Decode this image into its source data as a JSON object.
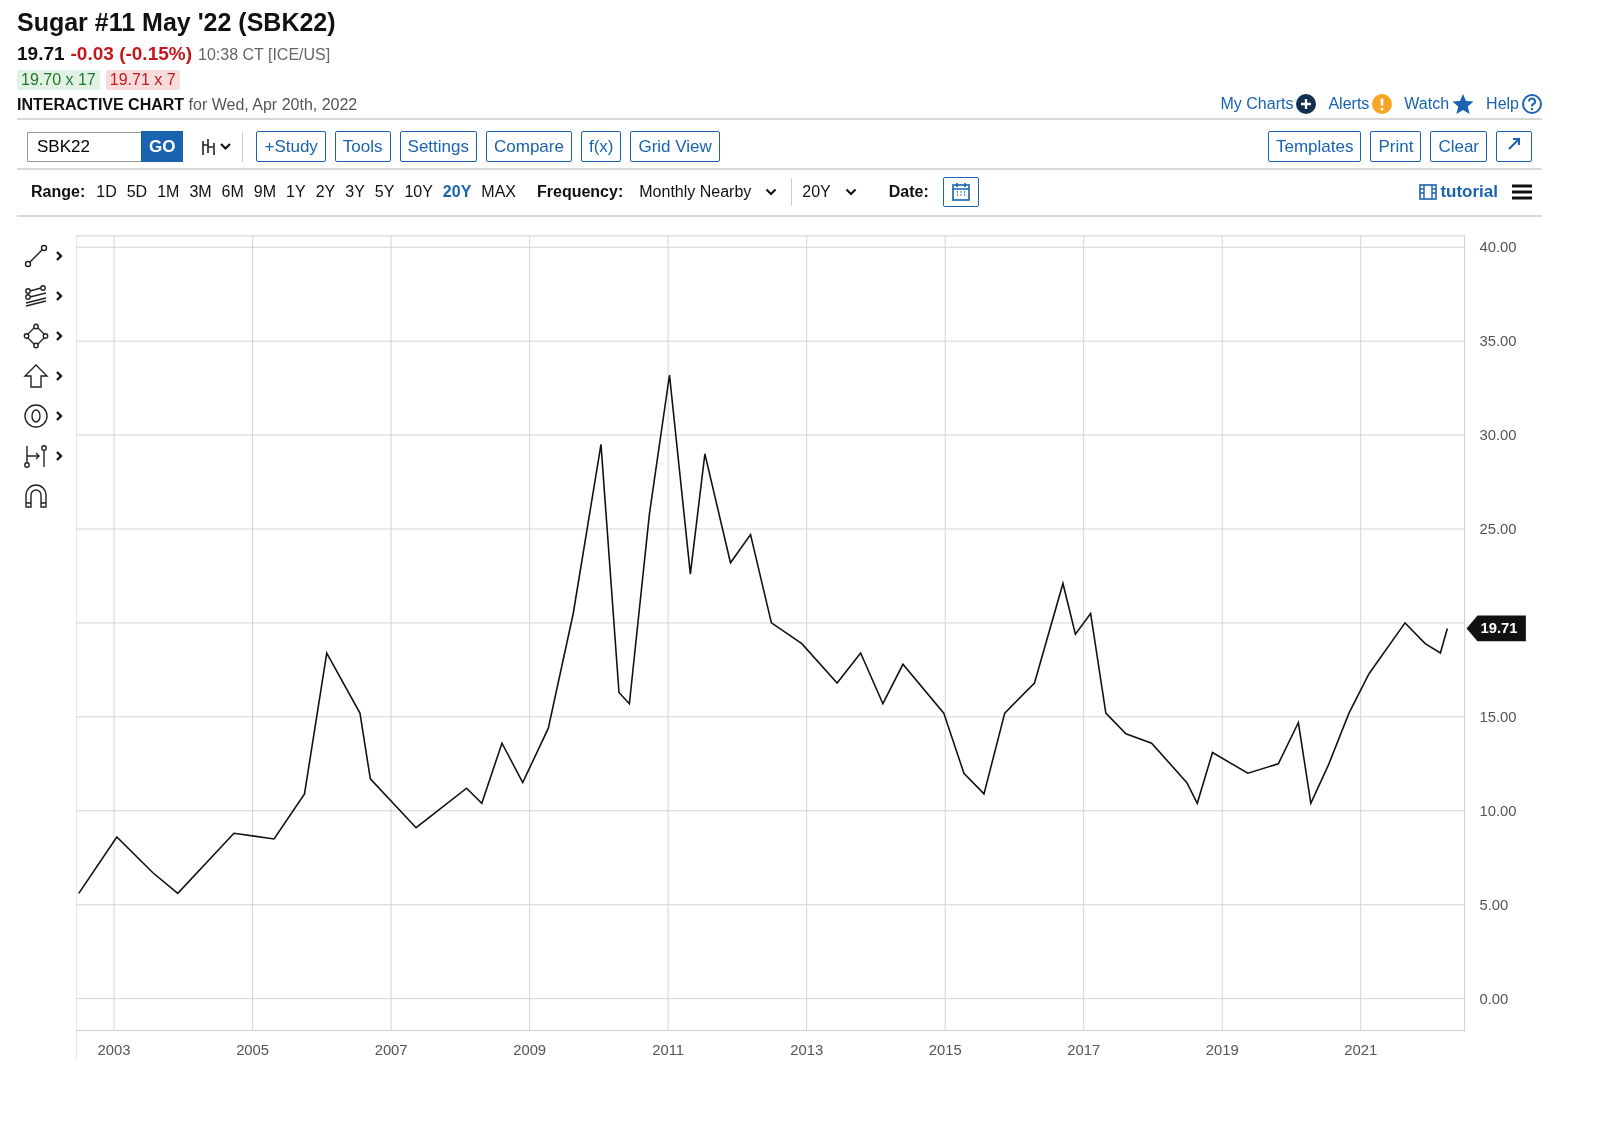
{
  "title": "Sugar #11 May '22 (SBK22)",
  "quote": {
    "last": "19.71",
    "change": "-0.03 (-0.15%)",
    "time": "10:38 CT [ICE/US]"
  },
  "bid": "19.70 x 17",
  "ask": "19.71 x 7",
  "chart_heading": {
    "label": "INTERACTIVE CHART",
    "date": "for Wed, Apr 20th, 2022"
  },
  "header_links": [
    {
      "label": "My Charts",
      "kind": "plus"
    },
    {
      "label": "Alerts",
      "kind": "alert"
    },
    {
      "label": "Watch",
      "kind": "star"
    },
    {
      "label": "Help",
      "kind": "help"
    }
  ],
  "symbol_input": {
    "value": "SBK22"
  },
  "go_button": "GO",
  "toolbar_buttons": [
    "+Study",
    "Tools",
    "Settings",
    "Compare",
    "f(x)",
    "Grid View"
  ],
  "right_buttons": [
    "Templates",
    "Print",
    "Clear"
  ],
  "range": {
    "label": "Range:",
    "options": [
      {
        "label": "1D",
        "selected": false
      },
      {
        "label": "5D",
        "selected": false
      },
      {
        "label": "1M",
        "selected": false
      },
      {
        "label": "3M",
        "selected": false
      },
      {
        "label": "6M",
        "selected": false
      },
      {
        "label": "9M",
        "selected": false
      },
      {
        "label": "1Y",
        "selected": false
      },
      {
        "label": "2Y",
        "selected": false
      },
      {
        "label": "3Y",
        "selected": false
      },
      {
        "label": "5Y",
        "selected": false
      },
      {
        "label": "10Y",
        "selected": false
      },
      {
        "label": "20Y",
        "selected": true
      },
      {
        "label": "MAX",
        "selected": false
      }
    ]
  },
  "frequency": {
    "label": "Frequency:",
    "value": "Monthly Nearby"
  },
  "period": {
    "value": "20Y"
  },
  "date": {
    "label": "Date:"
  },
  "tutorial": "tutorial",
  "drawing_tools": [
    {
      "kind": "line",
      "submenu": true
    },
    {
      "kind": "channel",
      "submenu": true
    },
    {
      "kind": "shape",
      "submenu": true
    },
    {
      "kind": "arrow",
      "submenu": true
    },
    {
      "kind": "circle",
      "submenu": true
    },
    {
      "kind": "measure",
      "submenu": true
    },
    {
      "kind": "magnet",
      "submenu": false
    }
  ],
  "chart": {
    "last_price_label": "19.71",
    "chart_data": {
      "type": "line",
      "xlim": [
        2002.45,
        2022.5
      ],
      "ylim": [
        -1.7,
        40.6
      ],
      "xticks": [
        {
          "value": 2003,
          "label": "2003"
        },
        {
          "value": 2005,
          "label": "2005"
        },
        {
          "value": 2007,
          "label": "2007"
        },
        {
          "value": 2009,
          "label": "2009"
        },
        {
          "value": 2011,
          "label": "2011"
        },
        {
          "value": 2013,
          "label": "2013"
        },
        {
          "value": 2015,
          "label": "2015"
        },
        {
          "value": 2017,
          "label": "2017"
        },
        {
          "value": 2019,
          "label": "2019"
        },
        {
          "value": 2021,
          "label": "2021"
        }
      ],
      "yticks": [
        {
          "value": 0,
          "label": "0.00"
        },
        {
          "value": 5,
          "label": "5.00"
        },
        {
          "value": 10,
          "label": "10.00"
        },
        {
          "value": 15,
          "label": "15.00"
        },
        {
          "value": 25,
          "label": "25.00"
        },
        {
          "value": 30,
          "label": "30.00"
        },
        {
          "value": 35,
          "label": "35.00"
        },
        {
          "value": 40,
          "label": "40.00"
        }
      ],
      "x": [
        2002.49,
        2003.04,
        2003.56,
        2003.92,
        2004.73,
        2005.31,
        2005.75,
        2006.07,
        2006.55,
        2006.7,
        2007.36,
        2008.09,
        2008.31,
        2008.6,
        2008.9,
        2009.27,
        2009.63,
        2010.03,
        2010.29,
        2010.44,
        2010.73,
        2011.02,
        2011.32,
        2011.53,
        2011.9,
        2012.19,
        2012.49,
        2012.93,
        2013.44,
        2013.78,
        2014.1,
        2014.39,
        2014.98,
        2015.27,
        2015.56,
        2015.86,
        2016.29,
        2016.7,
        2016.88,
        2017.1,
        2017.32,
        2017.61,
        2017.98,
        2018.49,
        2018.64,
        2018.86,
        2019.37,
        2019.81,
        2020.1,
        2020.28,
        2020.54,
        2020.83,
        2021.12,
        2021.64,
        2021.93,
        2022.15,
        2022.25
      ],
      "grid": true,
      "series": [
        {
          "color": "#111111",
          "values": [
            5.6,
            8.6,
            6.7,
            5.6,
            8.8,
            8.5,
            10.9,
            18.4,
            15.2,
            11.7,
            9.1,
            11.2,
            10.4,
            13.6,
            11.5,
            14.4,
            20.5,
            29.5,
            16.3,
            15.7,
            25.8,
            33.2,
            22.6,
            29.0,
            23.2,
            24.7,
            20.0,
            18.9,
            16.8,
            18.4,
            15.7,
            17.8,
            15.2,
            12.0,
            10.9,
            15.2,
            16.8,
            22.1,
            19.4,
            20.5,
            15.2,
            14.1,
            13.6,
            11.5,
            10.4,
            13.1,
            12.0,
            12.5,
            14.7,
            10.4,
            12.5,
            15.2,
            17.3,
            20.0,
            18.9,
            18.4,
            19.71
          ]
        }
      ]
    }
  }
}
